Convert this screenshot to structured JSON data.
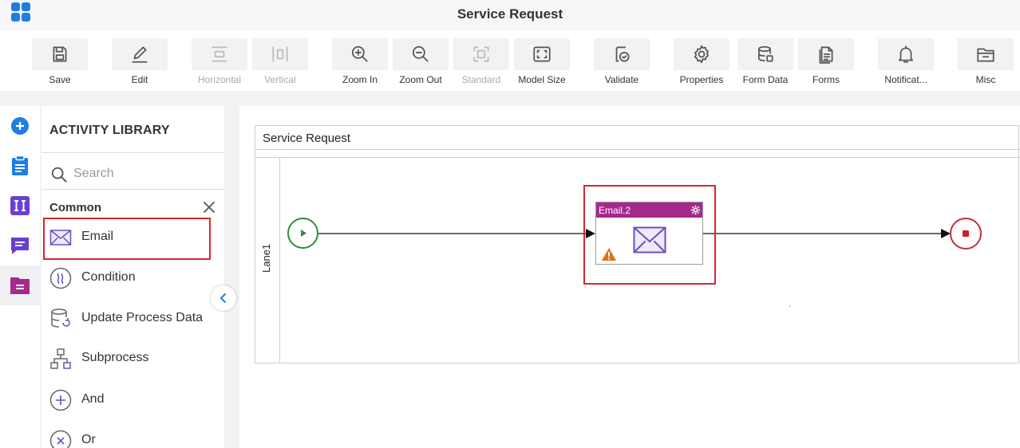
{
  "app": {
    "title": "Service Request"
  },
  "toolbar": {
    "items": [
      {
        "label": "Save",
        "icon": "save-icon",
        "disabled": false
      },
      {
        "label": "Edit",
        "icon": "edit-icon",
        "disabled": false
      },
      {
        "label": "Horizontal",
        "icon": "horizontal-layout-icon",
        "disabled": true
      },
      {
        "label": "Vertical",
        "icon": "vertical-layout-icon",
        "disabled": true
      },
      {
        "label": "Zoom In",
        "icon": "zoom-in-icon",
        "disabled": false
      },
      {
        "label": "Zoom Out",
        "icon": "zoom-out-icon",
        "disabled": false
      },
      {
        "label": "Standard",
        "icon": "standard-size-icon",
        "disabled": true
      },
      {
        "label": "Model Size",
        "icon": "model-size-icon",
        "disabled": false
      },
      {
        "label": "Validate",
        "icon": "validate-icon",
        "disabled": false
      },
      {
        "label": "Properties",
        "icon": "gear-icon",
        "disabled": false
      },
      {
        "label": "Form Data",
        "icon": "database-icon",
        "disabled": false
      },
      {
        "label": "Forms",
        "icon": "forms-icon",
        "disabled": false
      },
      {
        "label": "Notificat...",
        "icon": "bell-icon",
        "disabled": false
      },
      {
        "label": "Misc",
        "icon": "folder-icon",
        "disabled": false
      }
    ]
  },
  "rail": {
    "items": [
      {
        "icon": "add-circle-icon",
        "color": "#1e7ee4"
      },
      {
        "icon": "clipboard-icon",
        "color": "#1e7ee4"
      },
      {
        "icon": "variables-icon",
        "color": "#6b3fd1"
      },
      {
        "icon": "chat-icon",
        "color": "#6b3fd1"
      },
      {
        "icon": "document-icon",
        "color": "#a52a8c"
      }
    ]
  },
  "library": {
    "title": "ACTIVITY LIBRARY",
    "search_placeholder": "Search",
    "category": "Common",
    "items": [
      {
        "label": "Email",
        "icon": "email-icon"
      },
      {
        "label": "Condition",
        "icon": "condition-icon"
      },
      {
        "label": "Update Process Data",
        "icon": "update-data-icon"
      },
      {
        "label": "Subprocess",
        "icon": "subprocess-icon"
      },
      {
        "label": "And",
        "icon": "and-icon"
      },
      {
        "label": "Or",
        "icon": "or-icon"
      }
    ]
  },
  "canvas": {
    "pool_title": "Service Request",
    "lane_label": "Lane1",
    "task_title": "Email.2"
  },
  "colors": {
    "accent": "#1e7ee4",
    "task_header": "#a52a8c",
    "start": "#2e8b3a",
    "end": "#c0303a",
    "highlight": "#d9262d",
    "warning": "#d9741c"
  }
}
